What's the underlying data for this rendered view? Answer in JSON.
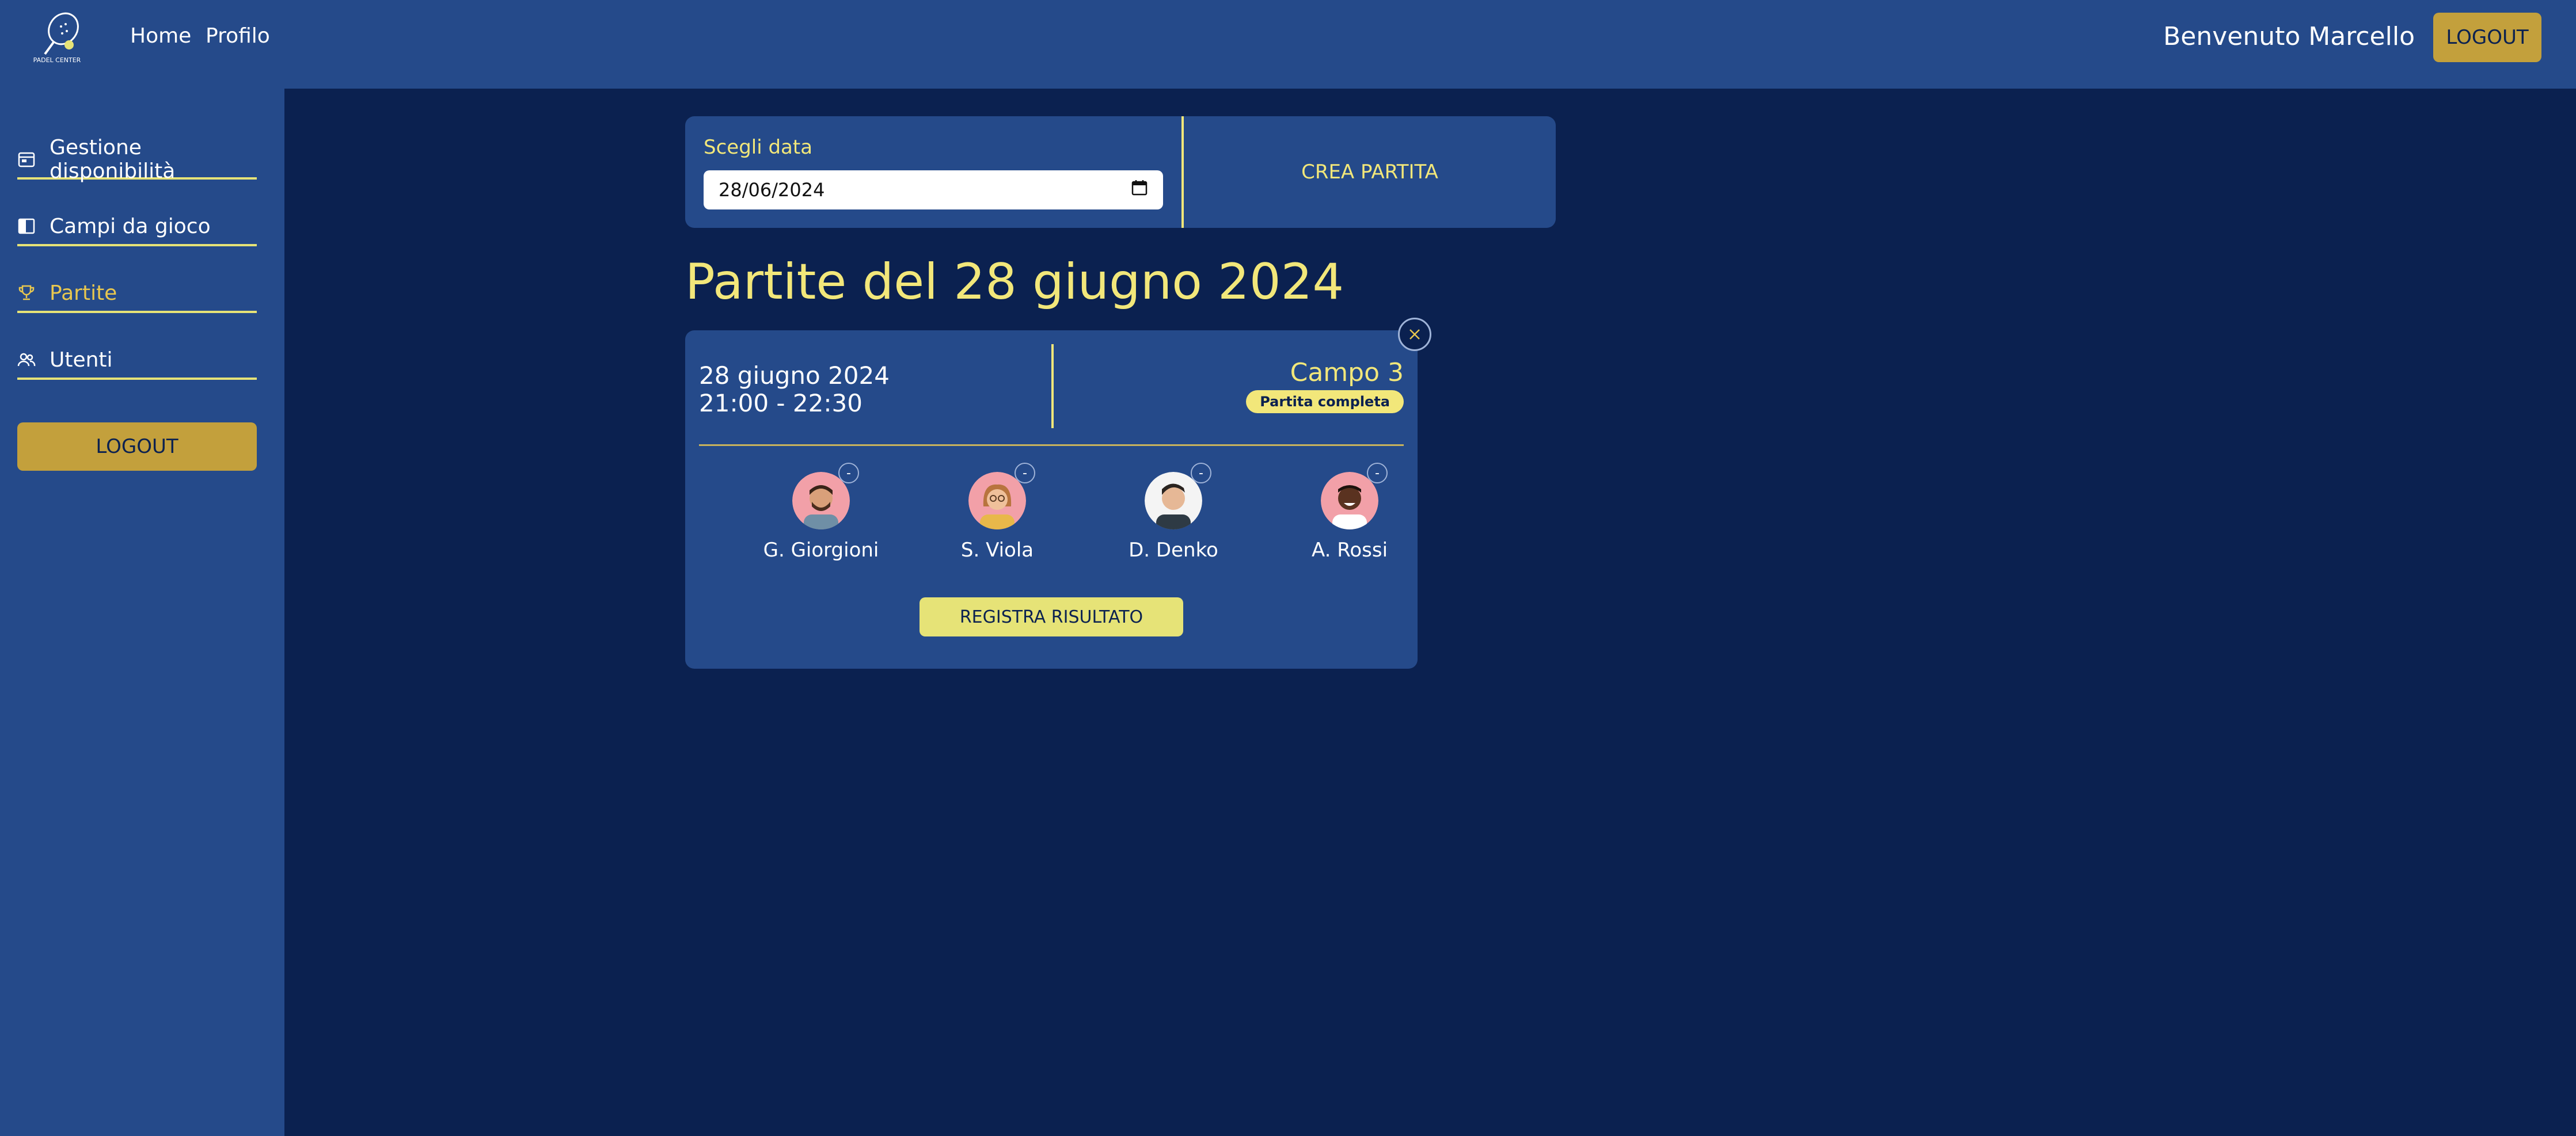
{
  "header": {
    "logo_text": "PADEL CENTER",
    "nav": [
      {
        "label": "Home"
      },
      {
        "label": "Profilo"
      }
    ],
    "welcome": "Benvenuto Marcello",
    "logout_label": "LOGOUT"
  },
  "sidebar": {
    "items": [
      {
        "label": "Gestione disponibilità",
        "icon": "calendar-icon",
        "active": false
      },
      {
        "label": "Campi da gioco",
        "icon": "court-icon",
        "active": false
      },
      {
        "label": "Partite",
        "icon": "trophy-icon",
        "active": true
      },
      {
        "label": "Utenti",
        "icon": "users-icon",
        "active": false
      }
    ],
    "logout_label": "LOGOUT"
  },
  "date_panel": {
    "label": "Scegli data",
    "value": "28/06/2024",
    "create_label": "CREA PARTITA"
  },
  "page_title": "Partite del 28 giugno 2024",
  "match": {
    "date": "28 giugno 2024",
    "time": "21:00 - 22:30",
    "court": "Campo 3",
    "status": "Partita completa",
    "remove_symbol": "-",
    "players": [
      {
        "name": "G. Giorgioni"
      },
      {
        "name": "S. Viola"
      },
      {
        "name": "D. Denko"
      },
      {
        "name": "A. Rossi"
      }
    ],
    "register_label": "REGISTRA RISULTATO"
  },
  "colors": {
    "background": "#0b2150",
    "panel": "#254a8a",
    "accent_yellow": "#f2e77a",
    "gold_button": "#c3a03c"
  }
}
